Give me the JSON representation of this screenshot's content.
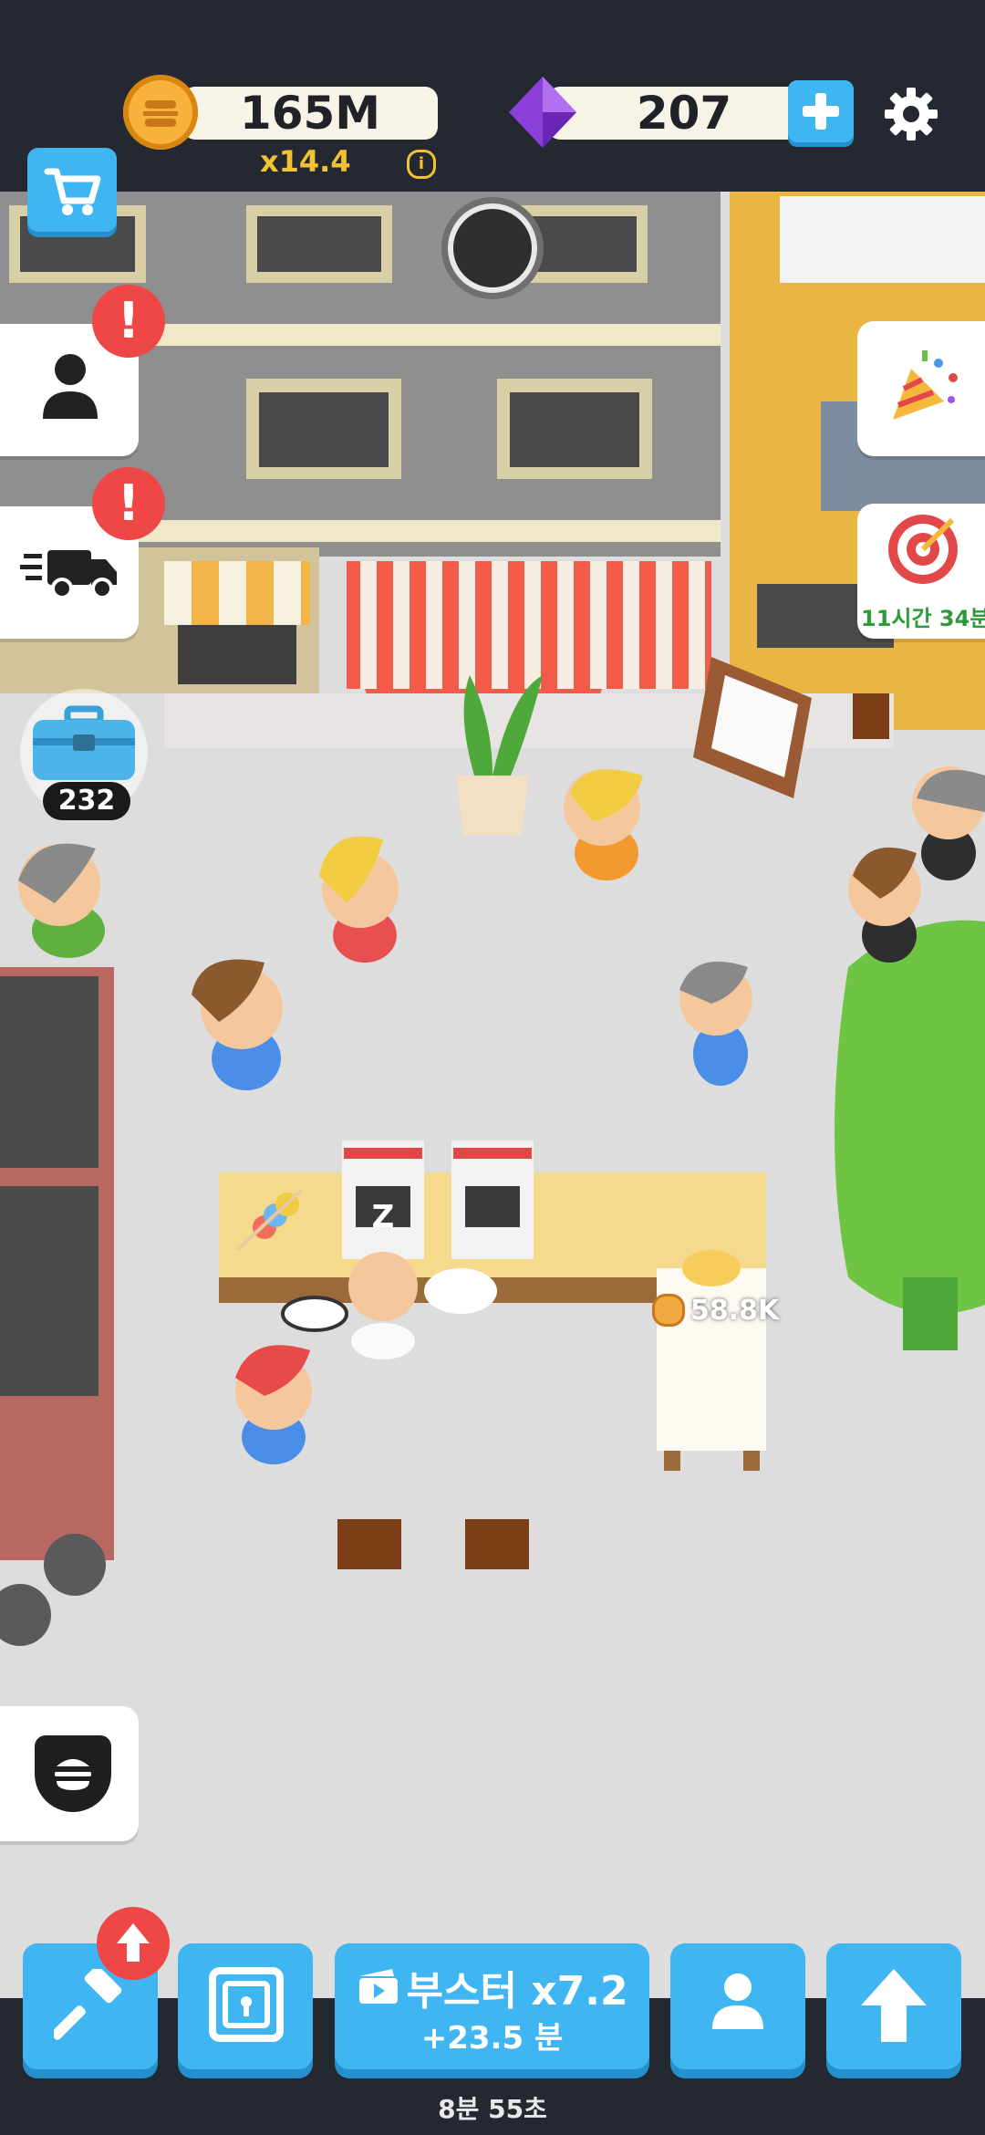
{
  "hud": {
    "coins": "165M",
    "multiplier": "x14.4",
    "gems": "207"
  },
  "side": {
    "crate_count": "232",
    "timer_label": "11시간 34분"
  },
  "scene": {
    "earning_label": "58.8K",
    "sleep_label": "Z"
  },
  "bottom": {
    "booster_title": "부스터 x7.2",
    "booster_sub": "+23.5 분",
    "countdown": "8분 55초"
  },
  "colors": {
    "accent_blue": "#3fb6f2",
    "alert_red": "#ef4646",
    "gold": "#f2c230",
    "gem_purple": "#8b3fd9"
  },
  "icons": [
    "coin-icon",
    "gem-icon",
    "plus-icon",
    "gear-icon",
    "cart-icon",
    "profile-icon",
    "truck-icon",
    "party-popper-icon",
    "target-icon",
    "toolbox-icon",
    "burger-icon",
    "hammer-icon",
    "safe-icon",
    "video-icon",
    "person-icon",
    "arrow-up-icon"
  ]
}
